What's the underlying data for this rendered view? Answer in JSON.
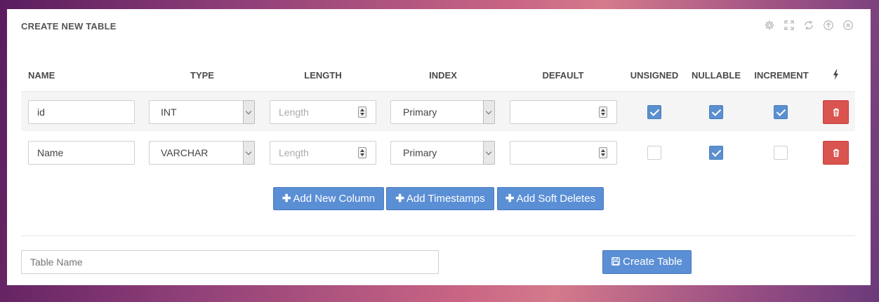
{
  "panel": {
    "title": "CREATE NEW TABLE",
    "tools": [
      "gear-icon",
      "expand-icon",
      "refresh-icon",
      "collapse-up-icon",
      "close-icon"
    ]
  },
  "headers": {
    "name": "NAME",
    "type": "TYPE",
    "length": "LENGTH",
    "index": "INDEX",
    "default": "DEFAULT",
    "unsigned": "UNSIGNED",
    "nullable": "NULLABLE",
    "increment": "INCREMENT",
    "actions_icon": "bolt-icon"
  },
  "rows": [
    {
      "name": "id",
      "type": "INT",
      "length_placeholder": "Length",
      "index": "Primary",
      "default": "",
      "unsigned": true,
      "nullable": true,
      "increment": true
    },
    {
      "name": "Name",
      "type": "VARCHAR",
      "length_placeholder": "Length",
      "index": "Primary",
      "default": "",
      "unsigned": false,
      "nullable": true,
      "increment": false
    }
  ],
  "buttons": {
    "add_column": "Add New Column",
    "add_timestamps": "Add Timestamps",
    "add_soft_deletes": "Add Soft Deletes",
    "create_table": "Create Table"
  },
  "table_name": {
    "placeholder": "Table Name",
    "value": ""
  },
  "colors": {
    "primary": "#5b8fd5",
    "danger": "#d9534f",
    "checked": "#5a8fd0"
  }
}
